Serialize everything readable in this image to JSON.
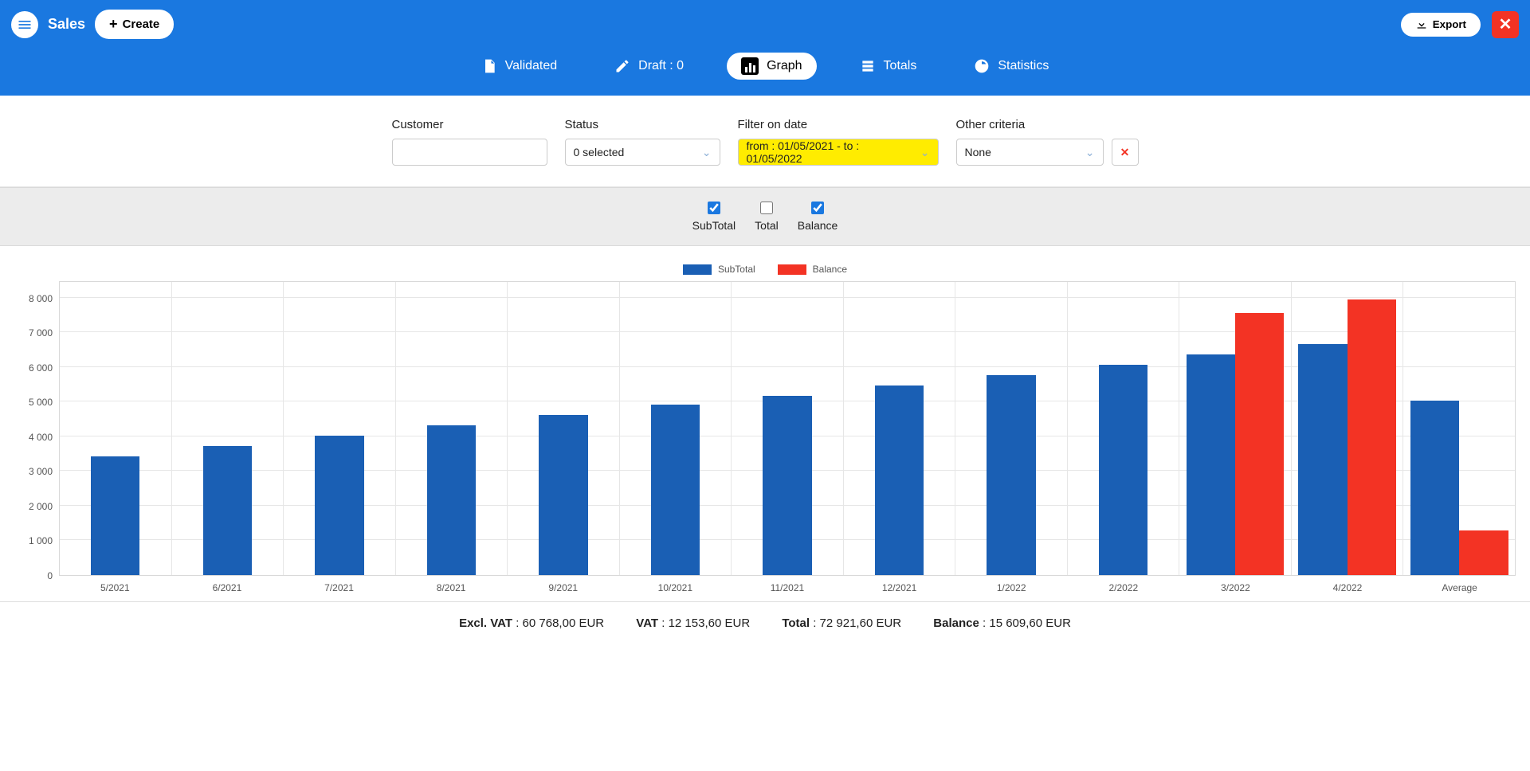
{
  "header": {
    "sales_label": "Sales",
    "create_label": "Create",
    "export_label": "Export"
  },
  "tabs": {
    "validated": "Validated",
    "draft": "Draft : 0",
    "graph": "Graph",
    "totals": "Totals",
    "statistics": "Statistics"
  },
  "filters": {
    "customer_label": "Customer",
    "customer_value": "",
    "status_label": "Status",
    "status_value": "0 selected",
    "date_label": "Filter on date",
    "date_value": "from : 01/05/2021 - to : 01/05/2022",
    "other_label": "Other criteria",
    "other_value": "None"
  },
  "checks": {
    "subtotal": "SubTotal",
    "total": "Total",
    "balance": "Balance"
  },
  "legend": {
    "subtotal": "SubTotal",
    "balance": "Balance"
  },
  "summary": {
    "exclvat_label": "Excl. VAT",
    "exclvat_value": " : 60 768,00 EUR",
    "vat_label": "VAT",
    "vat_value": " : 12 153,60 EUR",
    "total_label": "Total",
    "total_value": " : 72 921,60 EUR",
    "balance_label": "Balance",
    "balance_value": " : 15 609,60 EUR"
  },
  "chart_data": {
    "type": "bar",
    "ylim": [
      0,
      8500
    ],
    "yticks": [
      0,
      1000,
      2000,
      3000,
      4000,
      5000,
      6000,
      7000,
      8000
    ],
    "ytick_labels": [
      "0",
      "1 000",
      "2 000",
      "3 000",
      "4 000",
      "5 000",
      "6 000",
      "7 000",
      "8 000"
    ],
    "categories": [
      "5/2021",
      "6/2021",
      "7/2021",
      "8/2021",
      "9/2021",
      "10/2021",
      "11/2021",
      "12/2021",
      "1/2022",
      "2/2022",
      "3/2022",
      "4/2022",
      "Average"
    ],
    "series": [
      {
        "name": "SubTotal",
        "color": "#1a5fb4",
        "values": [
          3450,
          3750,
          4050,
          4350,
          4650,
          4950,
          5200,
          5500,
          5800,
          6100,
          6400,
          6700,
          5068
        ]
      },
      {
        "name": "Balance",
        "color": "#f33324",
        "values": [
          0,
          0,
          0,
          0,
          0,
          0,
          0,
          0,
          0,
          0,
          7600,
          8000,
          1300
        ]
      }
    ]
  }
}
